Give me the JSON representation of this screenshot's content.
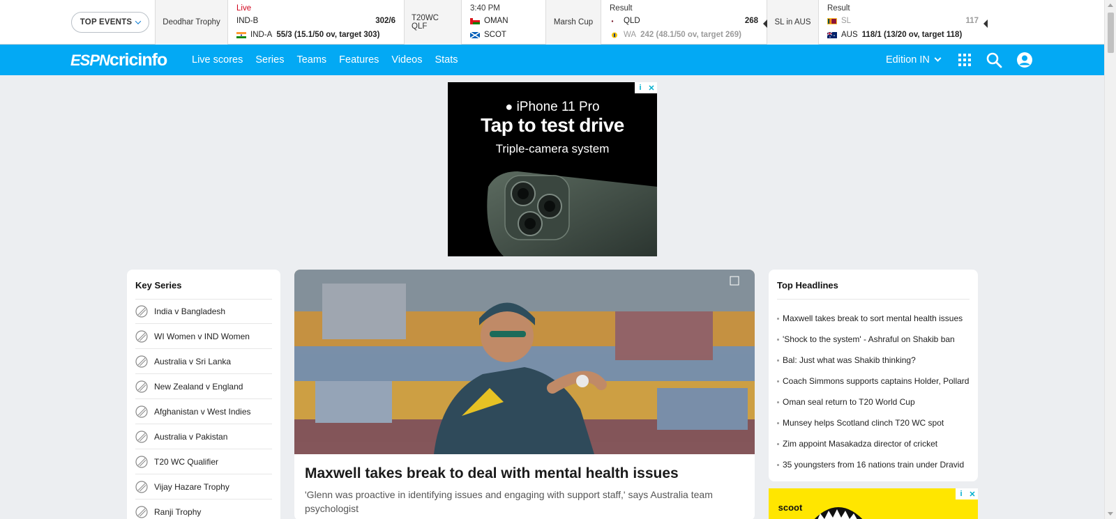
{
  "ticker": {
    "top_events_label": "TOP EVENTS",
    "blocks": [
      {
        "type": "series",
        "label": "Deodhar Trophy"
      },
      {
        "type": "match",
        "status": "Live",
        "live": true,
        "team1": {
          "name": "IND-B",
          "score": "302/6",
          "flag": "none"
        },
        "team2": {
          "name": "IND-A",
          "score": "55/3 (15.1/50 ov, target 303)",
          "flag": "india"
        }
      },
      {
        "type": "series",
        "label": "T20WC QLF"
      },
      {
        "type": "match",
        "status": "3:40 PM",
        "live": false,
        "team1": {
          "name": "OMAN",
          "score": "",
          "flag": "oman"
        },
        "team2": {
          "name": "SCOT",
          "score": "",
          "flag": "scotland"
        }
      },
      {
        "type": "series",
        "label": "Marsh Cup"
      },
      {
        "type": "match",
        "status": "Result",
        "live": false,
        "team1": {
          "name": "QLD",
          "score": "268",
          "flag": "qld"
        },
        "team2": {
          "name": "WA",
          "score": "242 (48.1/50 ov, target 269)",
          "flag": "wa",
          "muted": true
        }
      },
      {
        "type": "series",
        "label": "SL in AUS"
      },
      {
        "type": "match",
        "status": "Result",
        "live": false,
        "team1": {
          "name": "SL",
          "score": "117",
          "flag": "srilanka",
          "muted": true
        },
        "team2": {
          "name": "AUS",
          "score": "118/1 (13/20 ov, target 118)",
          "flag": "australia"
        }
      }
    ]
  },
  "nav": {
    "logo_espn": "ESPN",
    "logo_cricinfo": "cricinfo",
    "links": [
      "Live scores",
      "Series",
      "Teams",
      "Features",
      "Videos",
      "Stats"
    ],
    "edition": "Edition IN"
  },
  "ad": {
    "line1": "iPhone 11 Pro",
    "line2": "Tap to test drive",
    "line3": "Triple-camera system",
    "badge_info": "i",
    "badge_close": "✕"
  },
  "key_series": {
    "title": "Key Series",
    "items": [
      "India v Bangladesh",
      "WI Women v IND Women",
      "Australia v Sri Lanka",
      "New Zealand v England",
      "Afghanistan v West Indies",
      "Australia v Pakistan",
      "T20 WC Qualifier",
      "Vijay Hazare Trophy",
      "Ranji Trophy"
    ]
  },
  "hero": {
    "title": "Maxwell takes break to deal with mental health issues",
    "subtitle": "'Glenn was proactive in identifying issues and engaging with support staff,' says Australia team psychologist"
  },
  "headlines": {
    "title": "Top Headlines",
    "items": [
      "Maxwell takes break to sort mental health issues",
      "'Shock to the system' - Ashraful on Shakib ban",
      "Bal: Just what was Shakib thinking?",
      "Coach Simmons supports captains Holder, Pollard",
      "Oman seal return to T20 World Cup",
      "Munsey helps Scotland clinch T20 WC spot",
      "Zim appoint Masakadza director of cricket",
      "35 youngsters from 16 nations train under Dravid"
    ]
  },
  "ad2": {
    "brand": "scoot"
  },
  "colors": {
    "nav": "#03a9f4",
    "live": "#d0021b",
    "background": "#eceef1"
  }
}
